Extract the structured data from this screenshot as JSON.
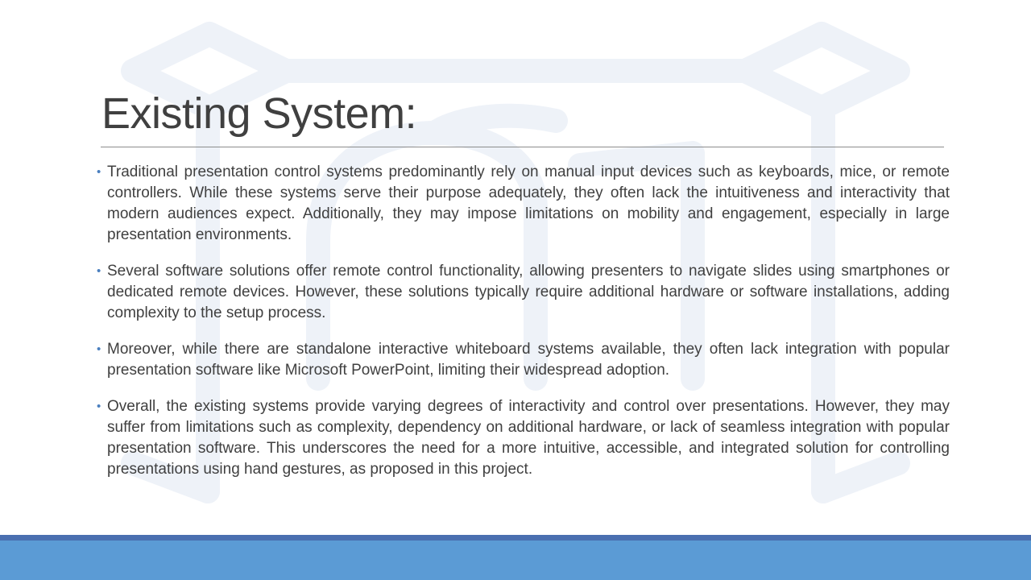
{
  "slide": {
    "title": "Existing System:",
    "bullets": [
      {
        "marker": "•",
        "text": "Traditional presentation control systems predominantly rely on manual input devices such as keyboards, mice, or remote controllers. While these systems serve their purpose adequately, they often lack the intuitiveness and interactivity that modern audiences expect. Additionally, they may impose limitations on mobility and engagement, especially in large presentation environments."
      },
      {
        "marker": "•",
        "text": "Several software solutions offer remote control functionality, allowing presenters to navigate slides using smartphones or dedicated remote devices. However, these solutions typically require additional hardware or software installations, adding complexity to the setup process."
      },
      {
        "marker": "•",
        "text": "Moreover, while there are standalone interactive whiteboard systems available, they often lack integration with popular presentation software like Microsoft PowerPoint, limiting their widespread adoption."
      },
      {
        "marker": "•",
        "text": "Overall, the existing systems provide varying degrees of interactivity and control over presentations. However, they may suffer from limitations such as complexity, dependency on additional hardware, or lack of seamless integration with popular presentation software. This underscores the need for a more intuitive, accessible, and integrated solution for controlling presentations using hand gestures, as proposed in this project."
      }
    ]
  },
  "colors": {
    "title_text": "#404040",
    "body_text": "#404040",
    "bullet_marker": "#4a7fbf",
    "footer_band": "#5b9bd5",
    "footer_line": "#4a6fb0",
    "watermark": "#eef2f8"
  },
  "icons": {
    "watermark": "faint-logo-watermark"
  }
}
